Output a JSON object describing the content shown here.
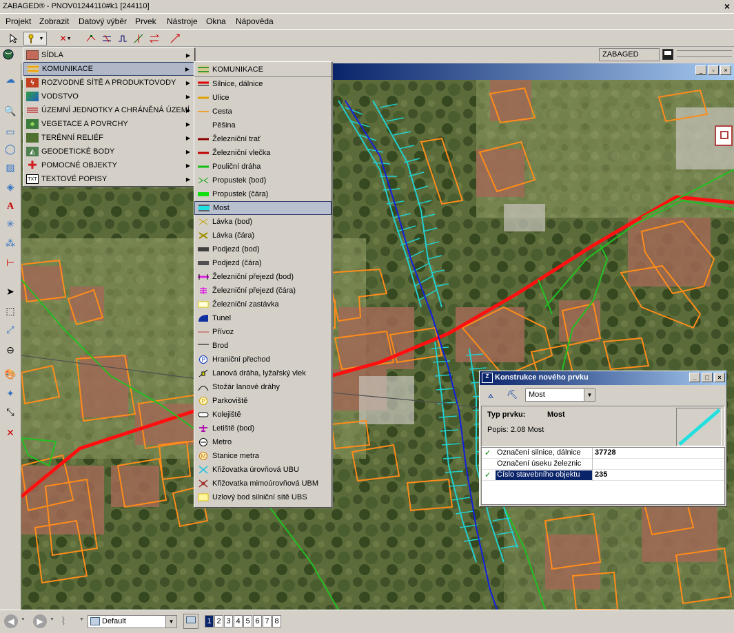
{
  "window": {
    "title": "ZABAGED® - PNOV01244110#k1 [244110]",
    "close": "×"
  },
  "menubar": [
    "Projekt",
    "Zobrazit",
    "Datový výběr",
    "Prvek",
    "Nástroje",
    "Okna",
    "Nápověda"
  ],
  "toolbar": {
    "layer_label": "ZABAGED"
  },
  "menu_categories": [
    {
      "label": "SÍDLA",
      "icon": "house-icon",
      "color": "#b04040"
    },
    {
      "label": "KOMUNIKACE",
      "icon": "road-icon",
      "color": "#e0a020"
    },
    {
      "label": "ROZVODNÉ SÍTĚ A PRODUKTOVODY",
      "icon": "network-icon",
      "color": "#b03000"
    },
    {
      "label": "VODSTVO",
      "icon": "water-icon",
      "color": "#2060c0"
    },
    {
      "label": "ÚZEMNÍ JEDNOTKY A CHRÁNĚNÁ ÚZEMÍ",
      "icon": "boundary-icon",
      "color": "#c04040"
    },
    {
      "label": "VEGETACE A POVRCHY",
      "icon": "tree-icon",
      "color": "#308030"
    },
    {
      "label": "TERÉNNÍ RELIÉF",
      "icon": "relief-icon",
      "color": "#406020"
    },
    {
      "label": "GEODETICKÉ BODY",
      "icon": "geodetic-icon",
      "color": "#206040"
    },
    {
      "label": "POMOCNÉ OBJEKTY",
      "icon": "cross-icon",
      "color": "#c02020"
    },
    {
      "label": "TEXTOVÉ POPISY",
      "icon": "text-icon",
      "color": "#000000"
    }
  ],
  "submenu": {
    "header": "KOMUNIKACE",
    "items": [
      {
        "label": "Silnice, dálnice",
        "icon": "road-line-icon"
      },
      {
        "label": "Ulice",
        "icon": "street-line-icon"
      },
      {
        "label": "Cesta",
        "icon": "path-line-icon"
      },
      {
        "label": "Pěšina",
        "icon": "footpath-line-icon"
      },
      {
        "label": "Železniční trať",
        "icon": "railway-line-icon"
      },
      {
        "label": "Železniční vlečka",
        "icon": "siding-line-icon"
      },
      {
        "label": "Pouliční dráha",
        "icon": "tram-line-icon"
      },
      {
        "label": "Propustek (bod)",
        "icon": "culvert-point-icon"
      },
      {
        "label": "Propustek (čára)",
        "icon": "culvert-line-icon"
      },
      {
        "label": "Most",
        "icon": "bridge-icon"
      },
      {
        "label": "Lávka (bod)",
        "icon": "footbridge-point-icon"
      },
      {
        "label": "Lávka (čára)",
        "icon": "footbridge-line-icon"
      },
      {
        "label": "Podjezd (bod)",
        "icon": "underpass-point-icon"
      },
      {
        "label": "Podjezd (čára)",
        "icon": "underpass-line-icon"
      },
      {
        "label": "Železniční přejezd (bod)",
        "icon": "crossing-point-icon"
      },
      {
        "label": "Železniční přejezd (čára)",
        "icon": "crossing-line-icon"
      },
      {
        "label": "Železniční zastávka",
        "icon": "station-icon"
      },
      {
        "label": "Tunel",
        "icon": "tunnel-icon"
      },
      {
        "label": "Přívoz",
        "icon": "ferry-icon"
      },
      {
        "label": "Brod",
        "icon": "ford-icon"
      },
      {
        "label": "Hraniční přechod",
        "icon": "border-crossing-icon"
      },
      {
        "label": "Lanová dráha, lyžařský vlek",
        "icon": "cableway-icon"
      },
      {
        "label": "Stožár lanové dráhy",
        "icon": "pylon-icon"
      },
      {
        "label": "Parkoviště",
        "icon": "parking-icon"
      },
      {
        "label": "Kolejiště",
        "icon": "rail-yard-icon"
      },
      {
        "label": "Letiště (bod)",
        "icon": "airport-icon"
      },
      {
        "label": "Metro",
        "icon": "metro-icon"
      },
      {
        "label": "Stanice metra",
        "icon": "metro-station-icon"
      },
      {
        "label": "Křižovatka úrovňová UBU",
        "icon": "junction-icon"
      },
      {
        "label": "Křižovatka mimoúrovňová UBM",
        "icon": "interchange-icon"
      },
      {
        "label": "Uzlový bod silniční sítě UBS",
        "icon": "node-icon"
      }
    ]
  },
  "dialog": {
    "title": "Konstrukce nového prvku",
    "selected_type": "Most",
    "type_label": "Typ prvku:",
    "type_value": "Most",
    "popis_label": "Popis:",
    "popis_value": "2.08 Most",
    "attributes": [
      {
        "name": "Označení silnice, dálnice",
        "value": "37728",
        "checked": true
      },
      {
        "name": "Označení  úseku železnic",
        "value": "",
        "checked": false
      },
      {
        "name": "Číslo stavebního objektu",
        "value": "235",
        "checked": true
      }
    ],
    "check": "✓"
  },
  "statusbar": {
    "view": "Default",
    "view_numbers": [
      "1",
      "2",
      "3",
      "4",
      "5",
      "6",
      "7",
      "8"
    ]
  }
}
